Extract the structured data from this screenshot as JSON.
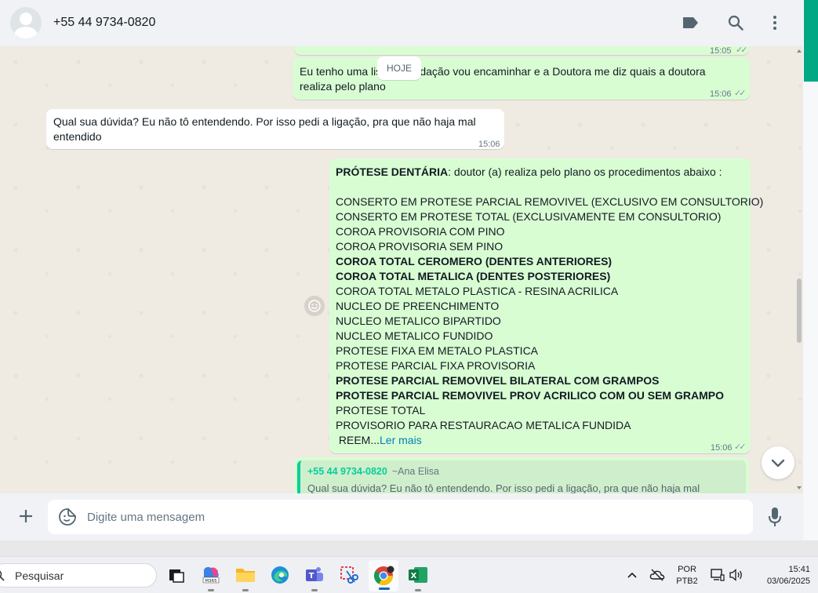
{
  "header": {
    "contact_name": "+55 44 9734-0820",
    "icons": [
      "label-icon",
      "search-icon",
      "menu-icon"
    ]
  },
  "chat": {
    "date_chip": "HOJE",
    "top_partial_time": "15:05",
    "messages": [
      {
        "direction": "out",
        "line1": "Eu tenho uma lista atualidação vou encaminhar e a Doutora me diz quais a doutora",
        "line2": "realiza pelo plano",
        "time": "15:06",
        "status": "read"
      },
      {
        "direction": "in",
        "line1": "Qual sua dúvida? Eu não tô entendendo. Por isso pedi a ligação, pra que não haja mal",
        "line2": "entendido",
        "time": "15:06"
      },
      {
        "direction": "out",
        "heading_bold": "PRÓTESE DENTÁRIA",
        "heading_rest": ": doutor (a) realiza pelo plano os procedimentos abaixo :",
        "lines": [
          {
            "text": "CONSERTO EM PROTESE PARCIAL REMOVIVEL (EXCLUSIVO EM CONSULTORIO)",
            "bold": false
          },
          {
            "text": "CONSERTO EM PROTESE TOTAL (EXCLUSIVAMENTE EM CONSULTORIO)",
            "bold": false
          },
          {
            "text": " COROA PROVISORIA COM PINO",
            "bold": false
          },
          {
            "text": " COROA PROVISORIA SEM PINO",
            "bold": false
          },
          {
            "text": " COROA TOTAL CEROMERO (DENTES ANTERIORES)",
            "bold": true
          },
          {
            "text": " COROA TOTAL METALICA (DENTES POSTERIORES)",
            "bold": true
          },
          {
            "text": " COROA TOTAL METALO PLASTICA - RESINA ACRILICA",
            "bold": false
          },
          {
            "text": " NUCLEO DE PREENCHIMENTO",
            "bold": false
          },
          {
            "text": " NUCLEO METALICO BIPARTIDO",
            "bold": false
          },
          {
            "text": " NUCLEO METALICO FUNDIDO",
            "bold": false
          },
          {
            "text": " PROTESE FIXA EM METALO PLASTICA",
            "bold": false
          },
          {
            "text": " PROTESE PARCIAL FIXA PROVISORIA",
            "bold": false
          },
          {
            "text": " PROTESE PARCIAL REMOVIVEL BILATERAL COM GRAMPOS",
            "bold": true
          },
          {
            "text": " PROTESE PARCIAL REMOVIVEL PROV ACRILICO COM OU SEM GRAMPO",
            "bold": true
          },
          {
            "text": " PROTESE TOTAL",
            "bold": false
          },
          {
            "text": " PROVISORIO PARA RESTAURACAO METALICA FUNDIDA",
            "bold": false
          }
        ],
        "truncated_text": " REEM...",
        "read_more": "Ler mais",
        "time": "15:06",
        "status": "read"
      }
    ],
    "quoted": {
      "author": "+55 44 9734-0820",
      "handle": "~Ana Elisa",
      "text": "Qual sua dúvida? Eu não tô entendendo. Por isso pedi a ligação, pra que não haja mal"
    }
  },
  "composer": {
    "placeholder": "Digite uma mensagem"
  },
  "taskbar": {
    "search_label": "Pesquisar",
    "apps": [
      "task-view",
      "microsoft-365",
      "file-explorer",
      "edge",
      "teams",
      "snipping-tool",
      "chrome",
      "excel"
    ],
    "language_line1": "POR",
    "language_line2": "PTB2",
    "time": "15:41",
    "date": "03/06/2025"
  },
  "colors": {
    "accent": "#00a884",
    "outgoing_bubble": "#d9fdd3",
    "incoming_bubble": "#ffffff",
    "chat_background": "#efeae2",
    "read_more_link": "#027eb5",
    "quote_author": "#06cf9c"
  }
}
